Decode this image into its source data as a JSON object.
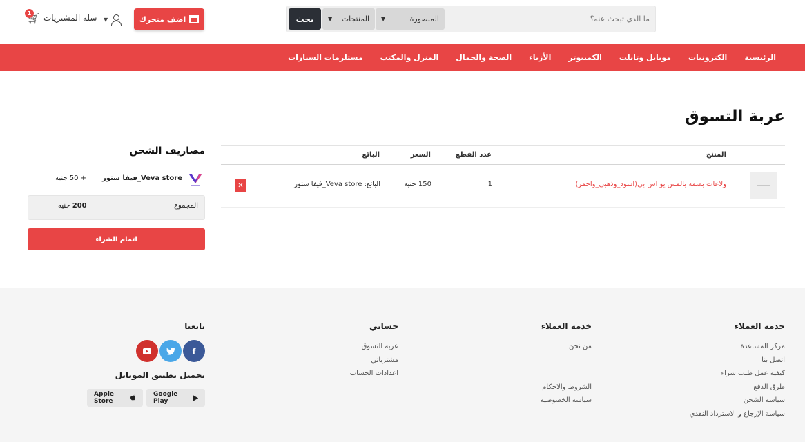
{
  "header": {
    "search_placeholder": "ما الذي تبحث عنه؟",
    "city_label": "المنصورة",
    "category_label": "المنتجات",
    "search_button": "بحث",
    "add_store_button": "اضف متجرك",
    "cart_label": "سلة المشتريات",
    "cart_count": "1"
  },
  "nav": {
    "items": [
      {
        "label": "الرئيسية"
      },
      {
        "label": "الكترونيات"
      },
      {
        "label": "موبايل وتابلت"
      },
      {
        "label": "الكمبيوتر"
      },
      {
        "label": "الأزياء"
      },
      {
        "label": "الصحة والجمال"
      },
      {
        "label": "المنزل والمكتب"
      },
      {
        "label": "مستلزمات السيارات"
      }
    ]
  },
  "cart": {
    "title": "عربة التسوق",
    "columns": {
      "product": "المنتج",
      "quantity": "عدد القطع",
      "price": "السعر",
      "seller": "البائع"
    },
    "rows": [
      {
        "product": "ولاعات بصمه بالمس يو اس بى(اسود_وذهبى_واحمر)",
        "quantity": "1",
        "price": "150 جنيه",
        "seller": "البائع: Veva store_فيفا ستور"
      }
    ]
  },
  "shipping": {
    "title": "مصاريف الشحن",
    "store_name": "Veva store_فيفا ستور",
    "store_cost": "+ 50 جنيه",
    "total_label": "المجموع",
    "total_value_amount": "200",
    "total_value_currency": "جنيه",
    "checkout_button": "اتمام الشراء"
  },
  "footer": {
    "col1": {
      "title": "خدمة العملاء",
      "links": [
        "مركز المساعدة",
        "اتصل بنا",
        "كيفية عمل طلب شراء",
        "طرق الدفع",
        "سياسة الشحن",
        "سياسة الإرجاع و الاسترداد النقدي"
      ]
    },
    "col2": {
      "title": "خدمة العملاء",
      "links_top": [
        "من نحن"
      ],
      "links_bottom": [
        "الشروط والاحكام",
        "سياسة الخصوصية"
      ]
    },
    "col3": {
      "title": "حسابي",
      "links": [
        "عربة التسوق",
        "مشترياتي",
        "اعدادات الحساب"
      ]
    },
    "follow_title": "تابعنا",
    "app_title": "تحميل تطبيق الموبايل",
    "google_play": "Google Play",
    "apple_store": "Apple Store"
  },
  "colors": {
    "accent": "#e84545",
    "dark_button": "#2b2f36",
    "facebook": "#3b5998",
    "twitter": "#4aa7e8",
    "youtube": "#d0312d"
  }
}
